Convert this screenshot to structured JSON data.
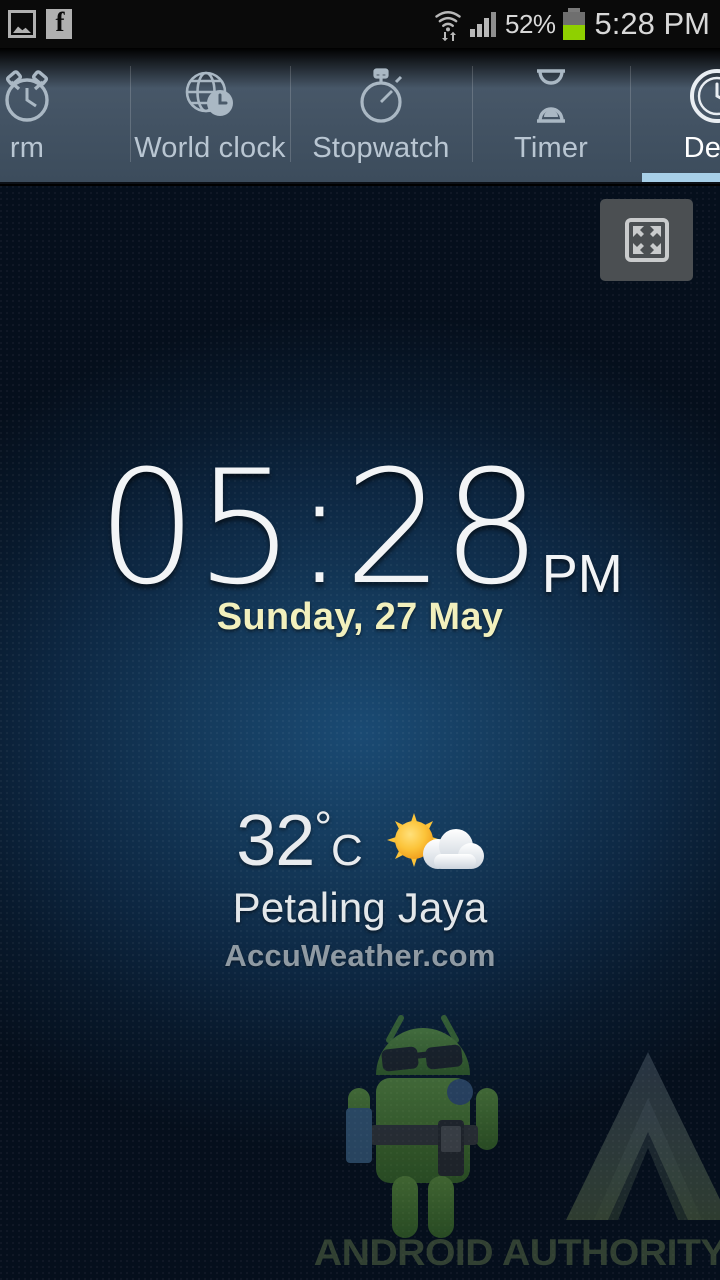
{
  "statusbar": {
    "icons_left": [
      "screenshot-icon",
      "facebook-icon"
    ],
    "wifi_icon": "wifi-data-transfer-icon",
    "signal_icon": "cellular-signal-icon",
    "battery_percent": "52%",
    "battery_icon": "battery-icon",
    "battery_level": 52,
    "battery_color": "#8fd000",
    "time": "5:28 PM"
  },
  "tabs": [
    {
      "label": "rm",
      "full_label": "Alarm",
      "icon": "alarm-clock-icon",
      "selected": false
    },
    {
      "label": "World clock",
      "icon": "globe-clock-icon",
      "selected": false
    },
    {
      "label": "Stopwatch",
      "icon": "stopwatch-icon",
      "selected": false
    },
    {
      "label": "Timer",
      "icon": "hourglass-icon",
      "selected": false
    },
    {
      "label": "Desk",
      "full_label": "Desk clock",
      "icon": "desk-clock-icon",
      "selected": true
    }
  ],
  "selected_tab_accent": "#a7cfe8",
  "deskclock": {
    "fullscreen_button": "fullscreen-expand-icon",
    "time": "05:28",
    "ampm": "PM",
    "date": "Sunday, 27 May",
    "date_color": "#f2f0bd",
    "weather": {
      "temperature": "32",
      "degree_symbol": "°",
      "unit": "C",
      "condition_icon": "partly-cloudy-sun-icon",
      "city": "Petaling Jaya",
      "provider": "AccuWeather.com"
    },
    "background_colors": {
      "center": "#1a4a73",
      "edge": "#050f1c"
    }
  },
  "watermark": {
    "text": "ANDROID AUTHORITY",
    "mascot": "android-mascot-sunglasses-icon",
    "logo": "triangle-a-logo-icon",
    "color": "#6d8250"
  }
}
